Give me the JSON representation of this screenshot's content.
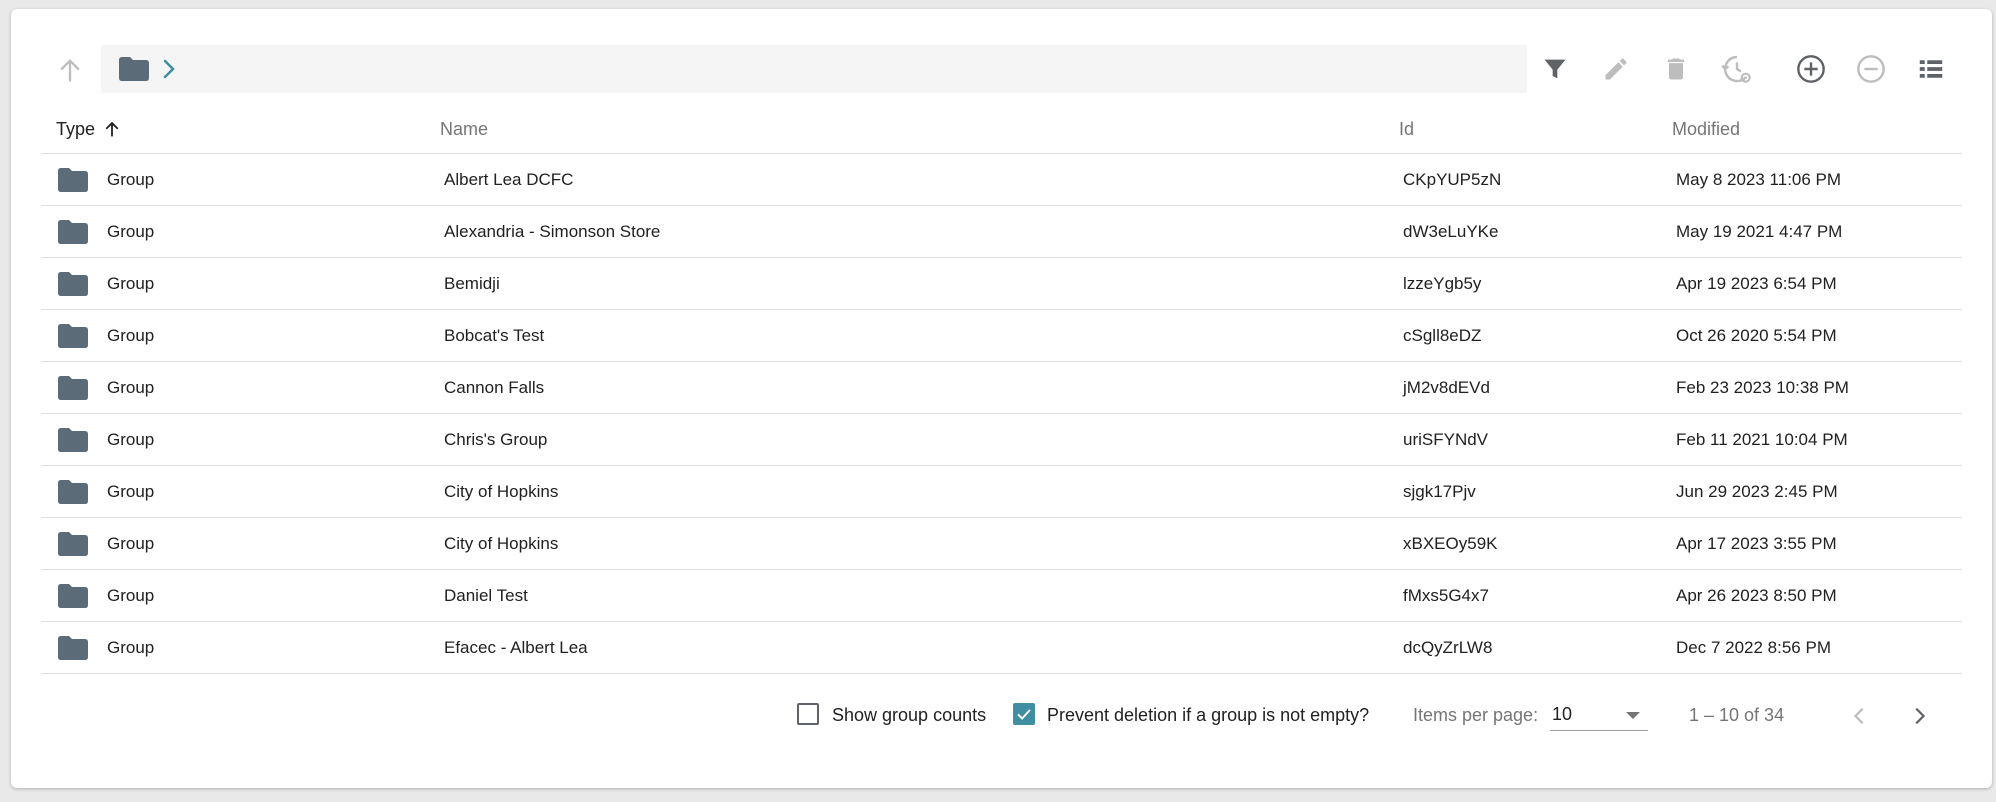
{
  "toolbar": {
    "icons": [
      "arrow-upward-icon",
      "folder-icon",
      "chevron-right-icon",
      "filter-icon",
      "edit-icon",
      "delete-icon",
      "history-settings-icon",
      "add-circle-icon",
      "remove-circle-icon",
      "view-list-icon"
    ]
  },
  "table": {
    "headers": {
      "type": "Type",
      "name": "Name",
      "id": "Id",
      "modified": "Modified"
    },
    "sort": {
      "column": "type",
      "direction": "ascending"
    },
    "rows": [
      {
        "type": "Group",
        "name": "Albert Lea DCFC",
        "id": "CKpYUP5zN",
        "modified": "May 8 2023 11:06 PM"
      },
      {
        "type": "Group",
        "name": "Alexandria - Simonson Store",
        "id": "dW3eLuYKe",
        "modified": "May 19 2021 4:47 PM"
      },
      {
        "type": "Group",
        "name": "Bemidji",
        "id": "lzzeYgb5y",
        "modified": "Apr 19 2023 6:54 PM"
      },
      {
        "type": "Group",
        "name": "Bobcat's Test",
        "id": "cSgll8eDZ",
        "modified": "Oct 26 2020 5:54 PM"
      },
      {
        "type": "Group",
        "name": "Cannon Falls",
        "id": "jM2v8dEVd",
        "modified": "Feb 23 2023 10:38 PM"
      },
      {
        "type": "Group",
        "name": "Chris's Group",
        "id": "uriSFYNdV",
        "modified": "Feb 11 2021 10:04 PM"
      },
      {
        "type": "Group",
        "name": "City of Hopkins",
        "id": "sjgk17Pjv",
        "modified": "Jun 29 2023 2:45 PM"
      },
      {
        "type": "Group",
        "name": "City of Hopkins",
        "id": "xBXEOy59K",
        "modified": "Apr 17 2023 3:55 PM"
      },
      {
        "type": "Group",
        "name": "Daniel Test",
        "id": "fMxs5G4x7",
        "modified": "Apr 26 2023 8:50 PM"
      },
      {
        "type": "Group",
        "name": "Efacec - Albert Lea",
        "id": "dcQyZrLW8",
        "modified": "Dec 7 2022 8:56 PM"
      }
    ]
  },
  "footer": {
    "show_group_counts": {
      "label": "Show group counts",
      "checked": false
    },
    "prevent_deletion": {
      "label": "Prevent deletion if a group is not empty?",
      "checked": true
    },
    "items_per_page_label": "Items per page:",
    "items_per_page_value": "10",
    "range_label": "1 – 10 of 34"
  },
  "colors": {
    "accent": "#3f8ea2",
    "folder": "#5b6b77",
    "icon_dark": "#5f6368",
    "icon_disabled": "#bdbdbd"
  }
}
